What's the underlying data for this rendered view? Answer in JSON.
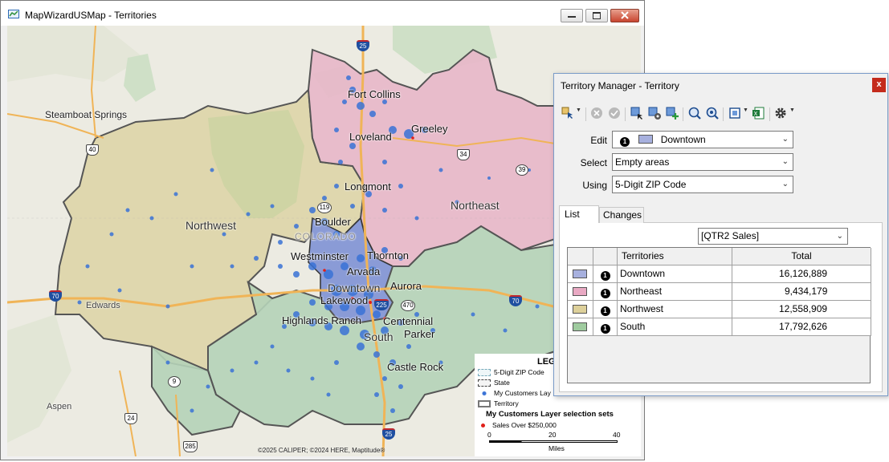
{
  "map_window": {
    "title": "MapWizardUSMap - Territories",
    "copyright": "©2025 CALIPER; ©2024 HERE, Maptitude®",
    "places": {
      "steamboat": "Steamboat Springs",
      "fort_collins": "Fort Collins",
      "loveland": "Loveland",
      "greeley": "Greeley",
      "longmont": "Longmont",
      "boulder": "Boulder",
      "colorado": "COLORADO",
      "westminster": "Westminster",
      "thornton": "Thornton",
      "arvada": "Arvada",
      "downtown": "Downtown",
      "aurora": "Aurora",
      "lakewood": "Lakewood",
      "highlands_ranch": "Highlands Ranch",
      "centennial": "Centennial",
      "parker": "Parker",
      "south": "South",
      "castle_rock": "Castle Rock",
      "northwest": "Northwest",
      "northeast": "Northeast",
      "edwards": "Edwards",
      "aspen": "Aspen"
    },
    "shields": {
      "i25_north": "25",
      "i25_south": "25",
      "i70_west": "70",
      "i70_east": "70",
      "i225": "225",
      "us40": "40",
      "us34": "34",
      "us24": "24",
      "us285": "285",
      "sh9": "9",
      "sh39": "39",
      "sh119": "119",
      "sh470": "470"
    },
    "legend": {
      "title": "LEG",
      "items": [
        "5-Digit ZIP Code",
        "State",
        "My Customers Lay",
        "Territory"
      ],
      "selection_title": "My Customers Layer selection sets",
      "selection_item": "Sales Over $250,000",
      "scale_ticks": [
        "0",
        "20",
        "40"
      ],
      "scale_unit": "Miles"
    },
    "colors": {
      "downtown": "#8a9bd6",
      "northeast": "#e6b7c8",
      "northwest": "#ddd4a4",
      "south": "#b5d3b8",
      "customers": "#3a73d6"
    }
  },
  "territory_manager": {
    "title": "Territory Manager - Territory",
    "close_glyph": "x",
    "form": {
      "edit_label": "Edit",
      "edit_value": "Downtown",
      "edit_badge": "1",
      "select_label": "Select",
      "select_value": "Empty areas",
      "using_label": "Using",
      "using_value": "5-Digit ZIP Code"
    },
    "tabs": {
      "list": "List",
      "changes": "Changes"
    },
    "field_dropdown": "[QTR2 Sales]",
    "table": {
      "headers": [
        "Territories",
        "Total"
      ],
      "rows": [
        {
          "badge": "1",
          "name": "Downtown",
          "total": "16,126,889",
          "color": "#a7b0de"
        },
        {
          "badge": "1",
          "name": "Northeast",
          "total": "9,434,179",
          "color": "#e9a9c3"
        },
        {
          "badge": "1",
          "name": "Northwest",
          "total": "12,558,909",
          "color": "#ddd09a"
        },
        {
          "badge": "1",
          "name": "South",
          "total": "17,792,626",
          "color": "#9fcb9f"
        }
      ]
    }
  }
}
